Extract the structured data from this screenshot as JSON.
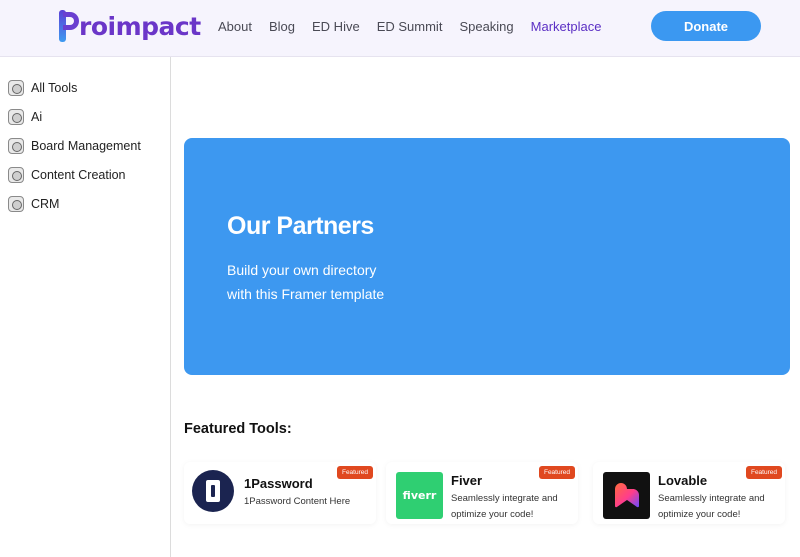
{
  "header": {
    "logo_text": "roimpact",
    "nav": [
      {
        "label": "About"
      },
      {
        "label": "Blog"
      },
      {
        "label": "ED Hive"
      },
      {
        "label": "ED Summit"
      },
      {
        "label": "Speaking"
      },
      {
        "label": "Marketplace",
        "active": true
      }
    ],
    "donate_label": "Donate",
    "accent_color": "#5b2fc4",
    "button_color": "#3b98f1"
  },
  "sidebar": {
    "items": [
      {
        "label": "All Tools",
        "icon": "category-icon"
      },
      {
        "label": "Ai",
        "icon": "category-icon"
      },
      {
        "label": "Board Management",
        "icon": "category-icon"
      },
      {
        "label": "Content Creation",
        "icon": "category-icon"
      },
      {
        "label": "CRM",
        "icon": "category-icon"
      }
    ]
  },
  "hero": {
    "title": "Our Partners",
    "subtitle_line1": "Build your own directory",
    "subtitle_line2": "with this Framer template",
    "color": "#3d98f0"
  },
  "featured": {
    "heading": "Featured Tools:",
    "cards": [
      {
        "name": "1Password",
        "description": "1Password Content Here",
        "badge": "Featured",
        "logo": "1password-logo"
      },
      {
        "name": "Fiver",
        "description": "Seamlessly integrate and optimize your code!",
        "badge": "Featured",
        "logo": "fiverr-logo",
        "logo_text": "fiverr"
      },
      {
        "name": "Lovable",
        "description": "Seamlessly integrate and optimize your code!",
        "badge": "Featured",
        "logo": "lovable-logo"
      }
    ],
    "badge_color": "#e0481f"
  }
}
